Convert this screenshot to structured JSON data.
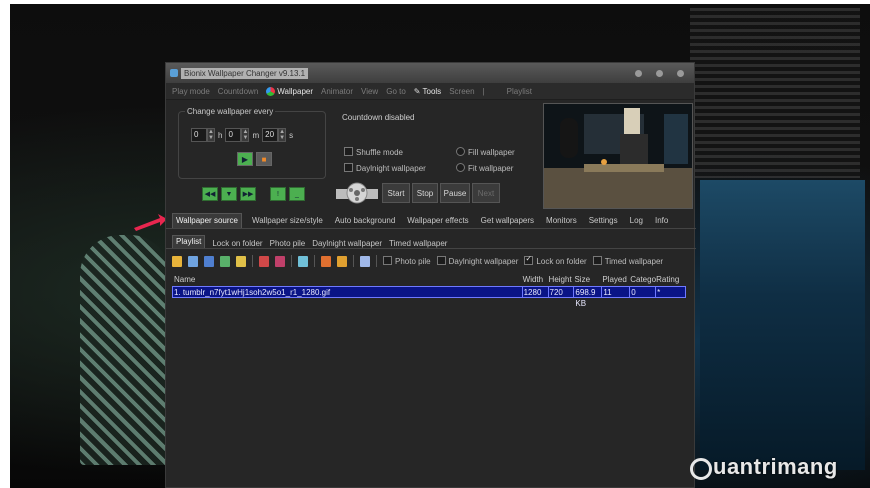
{
  "app": {
    "title": "Bionix Wallpaper Changer v9.13.1",
    "menu": [
      "Play mode",
      "Countdown",
      "Wallpaper",
      "Animator",
      "View",
      "Go to",
      "Tools",
      "Screen",
      "|",
      "Playlist"
    ],
    "active_menu": "Wallpaper"
  },
  "change_wallpaper": {
    "legend": "Change wallpaper every",
    "hours": "0",
    "hours_unit": "h",
    "minutes": "0",
    "minutes_unit": "m",
    "seconds": "20",
    "seconds_unit": "s"
  },
  "countdown": {
    "status": "Countdown disabled",
    "shuffle_label": "Shuffle mode",
    "daylight_label": "Daylnight wallpaper",
    "fill_label": "Fill wallpaper",
    "fit_label": "Fit wallpaper"
  },
  "controls": {
    "start": "Start",
    "stop": "Stop",
    "pause": "Pause",
    "next": "Next"
  },
  "main_tabs": [
    "Wallpaper source",
    "Wallpaper size/style",
    "Auto background",
    "Wallpaper effects",
    "Get wallpapers",
    "Monitors",
    "Settings",
    "Log",
    "Info"
  ],
  "sub_tabs": [
    "Playlist",
    "Lock on folder",
    "Photo pile",
    "Daylnight wallpaper",
    "Timed wallpaper"
  ],
  "toolbar_options": {
    "photo_pile": "Photo pile",
    "daylight": "Daylnight wallpaper",
    "lock_folder": "Lock on folder",
    "timed": "Timed wallpaper"
  },
  "table": {
    "headers": {
      "name": "Name",
      "width": "Width",
      "height": "Height",
      "size": "Size",
      "played": "Played",
      "category": "Catego",
      "rating": "Rating"
    },
    "rows": [
      {
        "name": "1. tumblr_n7fyt1wHj1soh2w5o1_r1_1280.gif",
        "width": "1280",
        "height": "720",
        "size": "698.9 KB",
        "played": "11",
        "category": "0",
        "rating": "*"
      }
    ]
  },
  "watermark": "uantrimang",
  "colors": {
    "accent_green": "#4caf50",
    "selection": "#0a1486"
  }
}
